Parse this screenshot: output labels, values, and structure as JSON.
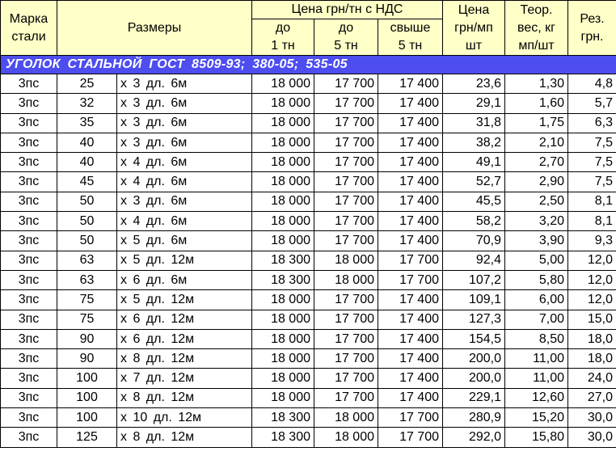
{
  "header": {
    "grade": "Марка стали",
    "grade_l1": "Марка",
    "grade_l2": "стали",
    "sizes": "Размеры",
    "price_group": "Цена грн/тн с НДС",
    "up_to_1_l1": "до",
    "up_to_1_l2": "1 тн",
    "up_to_5_l1": "до",
    "up_to_5_l2": "5 тн",
    "over_5_l1": "свыше",
    "over_5_l2": "5 тн",
    "price_per_m_l1": "Цена",
    "price_per_m_l2": "грн/мп",
    "price_per_m_l3": "шт",
    "weight_l1": "Теор.",
    "weight_l2": "вес, кг",
    "weight_l3": "мп/шт",
    "cut_l1": "Рез.",
    "cut_l2": "грн."
  },
  "section_title": "УГОЛОК  СТАЛЬНОЙ   ГОСТ  8509-93;  380-05;  535-05",
  "rows": [
    {
      "grade": "3пс",
      "size": "25",
      "dims": "x 3  дл. 6м",
      "p1": "18 000",
      "p5": "17 700",
      "p5p": "17 400",
      "price": "23,6",
      "weight": "1,30",
      "cut": "4,8"
    },
    {
      "grade": "3пс",
      "size": "32",
      "dims": "x 3  дл. 6м",
      "p1": "18 000",
      "p5": "17 700",
      "p5p": "17 400",
      "price": "29,1",
      "weight": "1,60",
      "cut": "5,7"
    },
    {
      "grade": "3пс",
      "size": "35",
      "dims": "x 3  дл. 6м",
      "p1": "18 000",
      "p5": "17 700",
      "p5p": "17 400",
      "price": "31,8",
      "weight": "1,75",
      "cut": "6,3"
    },
    {
      "grade": "3пс",
      "size": "40",
      "dims": "x 3  дл. 6м",
      "p1": "18 000",
      "p5": "17 700",
      "p5p": "17 400",
      "price": "38,2",
      "weight": "2,10",
      "cut": "7,5"
    },
    {
      "grade": "3пс",
      "size": "40",
      "dims": "x 4  дл. 6м",
      "p1": "18 000",
      "p5": "17 700",
      "p5p": "17 400",
      "price": "49,1",
      "weight": "2,70",
      "cut": "7,5"
    },
    {
      "grade": "3пс",
      "size": "45",
      "dims": "x 4  дл. 6м",
      "p1": "18 000",
      "p5": "17 700",
      "p5p": "17 400",
      "price": "52,7",
      "weight": "2,90",
      "cut": "7,5"
    },
    {
      "grade": "3пс",
      "size": "50",
      "dims": "x 3  дл. 6м",
      "p1": "18 000",
      "p5": "17 700",
      "p5p": "17 400",
      "price": "45,5",
      "weight": "2,50",
      "cut": "8,1"
    },
    {
      "grade": "3пс",
      "size": "50",
      "dims": "x 4  дл. 6м",
      "p1": "18 000",
      "p5": "17 700",
      "p5p": "17 400",
      "price": "58,2",
      "weight": "3,20",
      "cut": "8,1"
    },
    {
      "grade": "3пс",
      "size": "50",
      "dims": "x 5  дл. 6м",
      "p1": "18 000",
      "p5": "17 700",
      "p5p": "17 400",
      "price": "70,9",
      "weight": "3,90",
      "cut": "9,3"
    },
    {
      "grade": "3пс",
      "size": "63",
      "dims": "x 5  дл. 12м",
      "p1": "18 300",
      "p5": "18 000",
      "p5p": "17 700",
      "price": "92,4",
      "weight": "5,00",
      "cut": "12,0"
    },
    {
      "grade": "3пс",
      "size": "63",
      "dims": "x 6  дл. 6м",
      "p1": "18 300",
      "p5": "18 000",
      "p5p": "17 700",
      "price": "107,2",
      "weight": "5,80",
      "cut": "12,0"
    },
    {
      "grade": "3пс",
      "size": "75",
      "dims": "x 5  дл. 12м",
      "p1": "18 000",
      "p5": "17 700",
      "p5p": "17 400",
      "price": "109,1",
      "weight": "6,00",
      "cut": "12,0"
    },
    {
      "grade": "3пс",
      "size": "75",
      "dims": "x 6  дл. 12м",
      "p1": "18 000",
      "p5": "17 700",
      "p5p": "17 400",
      "price": "127,3",
      "weight": "7,00",
      "cut": "15,0"
    },
    {
      "grade": "3пс",
      "size": "90",
      "dims": "x 6  дл. 12м",
      "p1": "18 000",
      "p5": "17 700",
      "p5p": "17 400",
      "price": "154,5",
      "weight": "8,50",
      "cut": "18,0"
    },
    {
      "grade": "3пс",
      "size": "90",
      "dims": "x 8  дл. 12м",
      "p1": "18 000",
      "p5": "17 700",
      "p5p": "17 400",
      "price": "200,0",
      "weight": "11,00",
      "cut": "18,0"
    },
    {
      "grade": "3пс",
      "size": "100",
      "dims": "x 7  дл. 12м",
      "p1": "18 000",
      "p5": "17 700",
      "p5p": "17 400",
      "price": "200,0",
      "weight": "11,00",
      "cut": "24,0"
    },
    {
      "grade": "3пс",
      "size": "100",
      "dims": "x 8  дл. 12м",
      "p1": "18 000",
      "p5": "17 700",
      "p5p": "17 400",
      "price": "229,1",
      "weight": "12,60",
      "cut": "27,0"
    },
    {
      "grade": "3пс",
      "size": "100",
      "dims": "x 10  дл. 12м",
      "p1": "18 300",
      "p5": "18 000",
      "p5p": "17 700",
      "price": "280,9",
      "weight": "15,20",
      "cut": "30,0"
    },
    {
      "grade": "3пс",
      "size": "125",
      "dims": "x 8  дл. 12м",
      "p1": "18 300",
      "p5": "18 000",
      "p5p": "17 700",
      "price": "292,0",
      "weight": "15,80",
      "cut": "30,0"
    }
  ]
}
